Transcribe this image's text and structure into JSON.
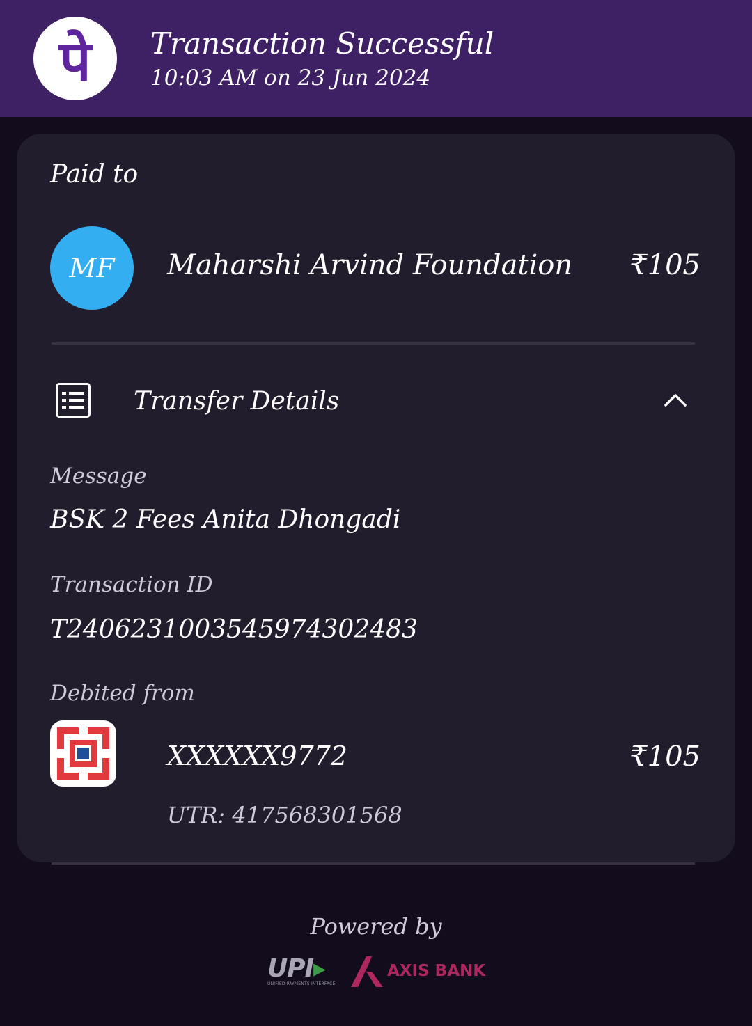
{
  "header": {
    "logo_glyph": "पे",
    "title": "Transaction Successful",
    "timestamp": "10:03 AM on 23 Jun 2024"
  },
  "payee": {
    "section_label": "Paid to",
    "initials": "MF",
    "name": "Maharshi Arvind Foundation",
    "amount": "₹105"
  },
  "details": {
    "title": "Transfer Details",
    "message_label": "Message",
    "message_value": "BSK 2 Fees Anita Dhongadi",
    "txn_label": "Transaction ID",
    "txn_value": "T2406231003545974302483",
    "debited_label": "Debited from",
    "account": "XXXXXX9772",
    "amount": "₹105",
    "utr": "UTR: 417568301568"
  },
  "footer": {
    "powered_by": "Powered by",
    "upi": "UPI",
    "upi_sub": "UNIFIED PAYMENTS INTERFACE",
    "bank": "AXIS BANK"
  },
  "colors": {
    "header_bg": "#3e2064",
    "brand_purple": "#5f259f",
    "avatar_blue": "#33aef0",
    "axis_maroon": "#ae285d",
    "hdfc_red": "#e03a3e",
    "hdfc_blue": "#1f4e9a"
  },
  "icons": [
    "phonepe-logo-icon",
    "list-details-icon",
    "chevron-up-icon",
    "hdfc-bank-icon",
    "upi-logo-icon",
    "axis-bank-logo-icon"
  ]
}
